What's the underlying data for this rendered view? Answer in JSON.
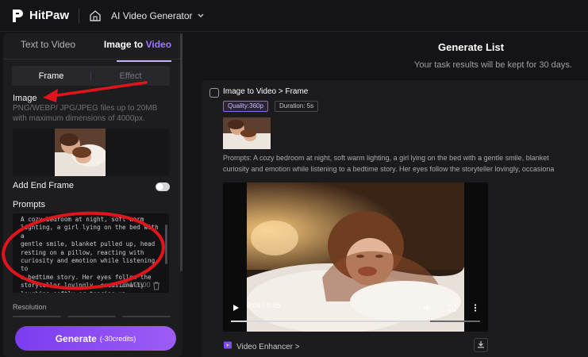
{
  "app": {
    "logo_text": "HitPaw",
    "product_title": "AI Video Generator"
  },
  "left_panel": {
    "tabs": [
      {
        "label": "Text to Video",
        "active": false
      },
      {
        "label_prefix": "Image to ",
        "label_accent": "Video",
        "active": true
      }
    ],
    "segments": [
      {
        "label": "Frame",
        "active": true
      },
      {
        "label": "Effect",
        "active": false
      }
    ],
    "image_label": "Image",
    "image_hint": "PNG/WEBP/ JPG/JPEG files up to 20MB with maximum dimensions of 4000px.",
    "end_frame_label": "Add End Frame",
    "end_frame_enabled": true,
    "prompts_label": "Prompts",
    "prompt_value": "A cozy bedroom at night, soft warm\nlighting, a girl lying on the bed with a\ngentle smile, blanket pulled up, head\nresting on a pillow, reacting with\ncuriosity and emotion while listening to\na bedtime story. Her eyes follow the\nstoryteller lovingly, occasionally\nlaughing softly or tearing up depending\non the story's highlights.",
    "prompt_counter": "304/2000",
    "resolution_label": "Resolution",
    "generate_label": "Generate",
    "generate_credits": "(-30credits)"
  },
  "right_panel": {
    "title": "Generate List",
    "subtitle": "Your task results will be kept for 30 days.",
    "task": {
      "title": "Image to Video > Frame",
      "quality": "Quality:360p",
      "duration": "Duration: 5s",
      "prompt_line1": "Prompts:  A cozy bedroom at night, soft warm lighting, a girl lying on the bed with a gentle smile, blanket",
      "prompt_line2": "curiosity and emotion while listening to a bedtime story. Her eyes follow the storyteller lovingly, occasiona",
      "video_time": "0:04 / 0:05",
      "video_progress": 0.8,
      "enhancer_label": "Video Enhancer >"
    }
  },
  "colors": {
    "accent": "#9c7bff",
    "button_gradient_start": "#7a3df0",
    "button_gradient_end": "#9d5cf5",
    "annotation": "#e0151b"
  },
  "icons": [
    "hitpaw-logo-icon",
    "home-icon",
    "chevron-down-icon",
    "trash-icon",
    "play-icon",
    "volume-icon",
    "fullscreen-icon",
    "more-vert-icon",
    "video-enhancer-icon",
    "download-icon",
    "task-icon"
  ]
}
